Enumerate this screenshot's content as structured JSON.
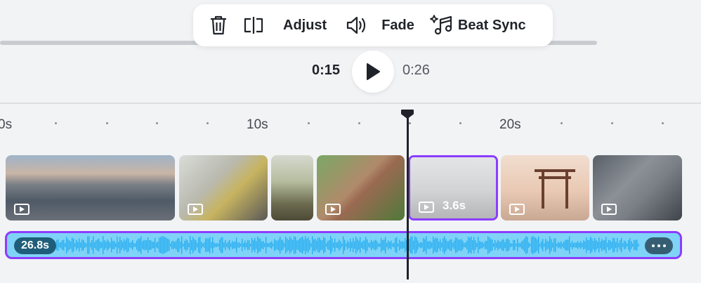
{
  "toolbar": {
    "delete_icon": "trash-icon",
    "split_icon": "split-icon",
    "adjust_label": "Adjust",
    "volume_icon": "volume-icon",
    "fade_label": "Fade",
    "beat_sync_icon": "sparkle-music-icon",
    "beat_sync_label": "Beat Sync"
  },
  "playback": {
    "current_time": "0:15",
    "total_time": "0:26",
    "play_icon": "play-icon"
  },
  "ruler": {
    "labels": [
      "0s",
      "10s",
      "20s"
    ]
  },
  "clips": [
    {
      "name": "city-skyline"
    },
    {
      "name": "girl-at-laptop"
    },
    {
      "name": "food-bowl"
    },
    {
      "name": "red-panda"
    },
    {
      "name": "foggy-motorbike",
      "duration": "3.6s",
      "selected": true
    },
    {
      "name": "torii-gate"
    },
    {
      "name": "milky-way"
    }
  ],
  "audio": {
    "duration": "26.8s",
    "more_icon": "more-dots-icon"
  },
  "colors": {
    "accent": "#8b3dff",
    "audio_fill": "#7fd3f7",
    "audio_wave": "#29aef0"
  }
}
